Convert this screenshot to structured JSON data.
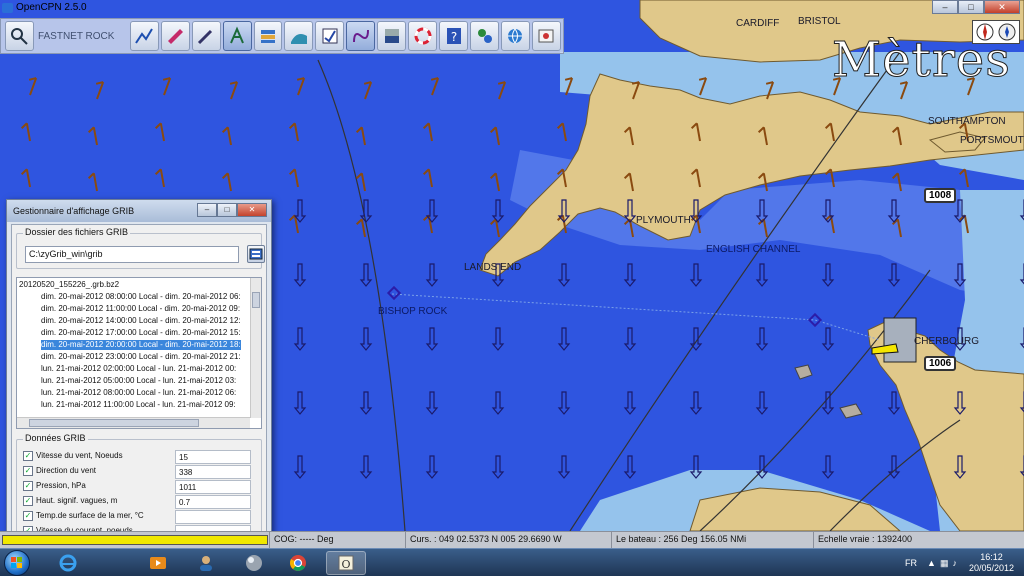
{
  "app": {
    "title": "OpenCPN 2.5.0",
    "window_controls": {
      "minimize": "–",
      "maximize": "□",
      "close": "✕"
    }
  },
  "toolbar": {
    "current_location_label": "FASTNET ROCK",
    "buttons": [
      {
        "name": "zoom-icon",
        "active": false
      },
      {
        "name": "route-icon",
        "active": false
      },
      {
        "name": "boat-icon",
        "active": false
      },
      {
        "name": "pen-icon",
        "active": false
      },
      {
        "name": "text-tool-icon",
        "active": true
      },
      {
        "name": "layers-icon",
        "active": false
      },
      {
        "name": "tide-icon",
        "active": false
      },
      {
        "name": "chart-check-icon",
        "active": false
      },
      {
        "name": "curve-icon",
        "active": true
      },
      {
        "name": "depth-icon",
        "active": false
      },
      {
        "name": "lifebuoy-icon",
        "active": false
      },
      {
        "name": "help-icon",
        "active": false
      },
      {
        "name": "grib-icon",
        "active": false
      },
      {
        "name": "globe-icon",
        "active": false
      },
      {
        "name": "settings-icon",
        "active": false
      }
    ]
  },
  "map": {
    "units_label": "Mètres",
    "colors": {
      "sea_deep": "#2f55e0",
      "sea_mid": "#5277ea",
      "shallow": "#95c3ec",
      "land": "#e0c88a"
    },
    "places": {
      "cardiff": "CARDIFF",
      "bristol": "BRISTOL",
      "southampton": "SOUTHAMPTON",
      "portsmouth": "PORTSMOUTH",
      "plymouth": "PLYMOUTH",
      "lands_end": "LANDS END",
      "english_channel": "ENGLISH CHANNEL",
      "bishop_rock": "BISHOP ROCK",
      "cherbourg": "CHERBOURG"
    },
    "route_badges": [
      "1008",
      "1006"
    ]
  },
  "grib_dialog": {
    "title": "Gestionnaire d'affichage GRIB",
    "folder_group_title": "Dossier des fichiers GRIB",
    "folder_path": "C:\\zyGrib_win\\grib",
    "tree": {
      "root": "20120520_155226_.grb.bz2",
      "entries": [
        "dim. 20-mai-2012 08:00:00 Local - dim. 20-mai-2012 06:",
        "dim. 20-mai-2012 11:00:00 Local - dim. 20-mai-2012 09:",
        "dim. 20-mai-2012 14:00:00 Local - dim. 20-mai-2012 12:",
        "dim. 20-mai-2012 17:00:00 Local - dim. 20-mai-2012 15:",
        "dim. 20-mai-2012 20:00:00 Local - dim. 20-mai-2012 18:",
        "dim. 20-mai-2012 23:00:00 Local - dim. 20-mai-2012 21:",
        "lun. 21-mai-2012 02:00:00 Local - lun. 21-mai-2012 00:",
        "lun. 21-mai-2012 05:00:00 Local - lun. 21-mai-2012 03:",
        "lun. 21-mai-2012 08:00:00 Local - lun. 21-mai-2012 06:",
        "lun. 21-mai-2012 11:00:00 Local - lun. 21-mai-2012 09:"
      ],
      "selected_index": 4
    },
    "data_group_title": "Données GRIB",
    "data": [
      {
        "label": "Vitesse du vent, Noeuds",
        "checked": true,
        "value": "15"
      },
      {
        "label": "Direction du vent",
        "checked": true,
        "value": "338"
      },
      {
        "label": "Pression, hPa",
        "checked": true,
        "value": "1011"
      },
      {
        "label": "Haut. signif. vagues, m",
        "checked": true,
        "value": "0.7"
      },
      {
        "label": "Temp.de surface de la mer, °C",
        "checked": true,
        "value": ""
      },
      {
        "label": "Vitesse du courant, noeuds.",
        "checked": true,
        "value": ""
      }
    ]
  },
  "statusbar": {
    "progress_fraction": 1.0,
    "cog": "COG: ----- Deg",
    "cursor": "Curs. : 049 02.5373 N 005 29.6690 W",
    "boat": "Le bateau : 256 Deg  156.05 NMi",
    "scale": "Echelle vraie :  1392400"
  },
  "taskbar": {
    "apps": [
      "ie-icon",
      "media-player-icon",
      "user-icon",
      "sphere-icon",
      "chrome-icon",
      "opencpn-icon"
    ],
    "language": "FR",
    "time": "16:12",
    "date": "20/05/2012"
  }
}
